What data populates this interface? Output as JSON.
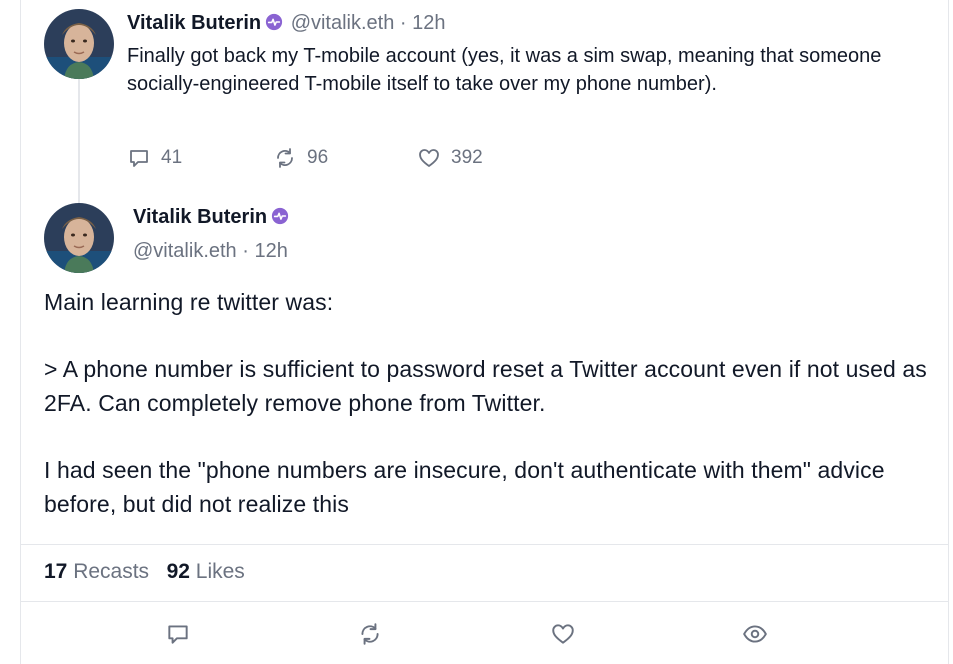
{
  "parent_cast": {
    "author_name": "Vitalik Buterin",
    "verified_badge_icon": "verified-purple-badge-icon",
    "handle": "@vitalik.eth",
    "separator": "·",
    "time": "12h",
    "text": "Finally got back my T-mobile account (yes, it was a sim swap, meaning that someone socially-engineered T-mobile itself to take over my phone number).",
    "replies": "41",
    "recasts": "96",
    "likes": "392"
  },
  "main_cast": {
    "author_name": "Vitalik Buterin",
    "verified_badge_icon": "verified-purple-badge-icon",
    "handle": "@vitalik.eth",
    "separator": "·",
    "time": "12h",
    "paragraphs": [
      "Main learning re twitter was:",
      "> A phone number is sufficient to password reset a Twitter account even if not used as 2FA. Can completely remove phone from Twitter.",
      "I had seen the \"phone numbers are insecure, don't authenticate with them\" advice before, but did not realize this"
    ],
    "recasts_count": "17",
    "recasts_label": "Recasts",
    "likes_count": "92",
    "likes_label": "Likes"
  },
  "bottom_actions": [
    "reply-icon",
    "recast-icon",
    "like-icon",
    "watch-icon"
  ],
  "colors": {
    "badge": "#8a63d2",
    "muted": "#6b7280",
    "text": "#111827",
    "border": "#e5e7eb"
  }
}
